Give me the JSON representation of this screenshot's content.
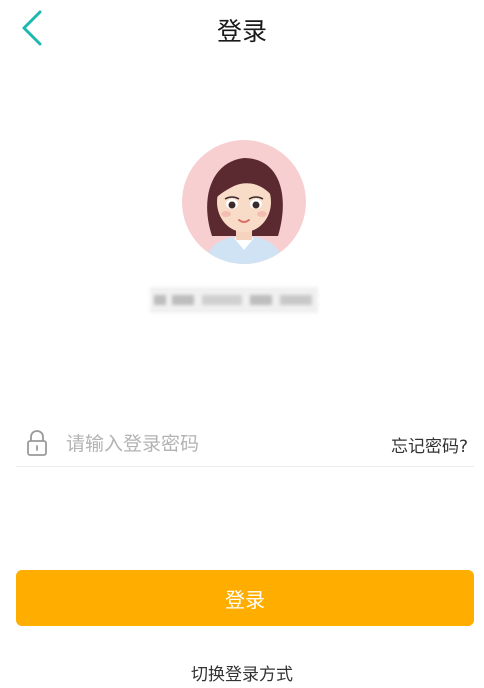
{
  "header": {
    "title": "登录",
    "back_icon": "chevron-left-icon",
    "accent_color": "#1fb8b0"
  },
  "account": {
    "masked": true
  },
  "password": {
    "placeholder": "请输入登录密码",
    "value": "",
    "lock_icon": "lock-icon"
  },
  "forgot_label": "忘记密码?",
  "login_button": {
    "label": "登录",
    "color": "#ffae00"
  },
  "switch_label": "切换登录方式"
}
